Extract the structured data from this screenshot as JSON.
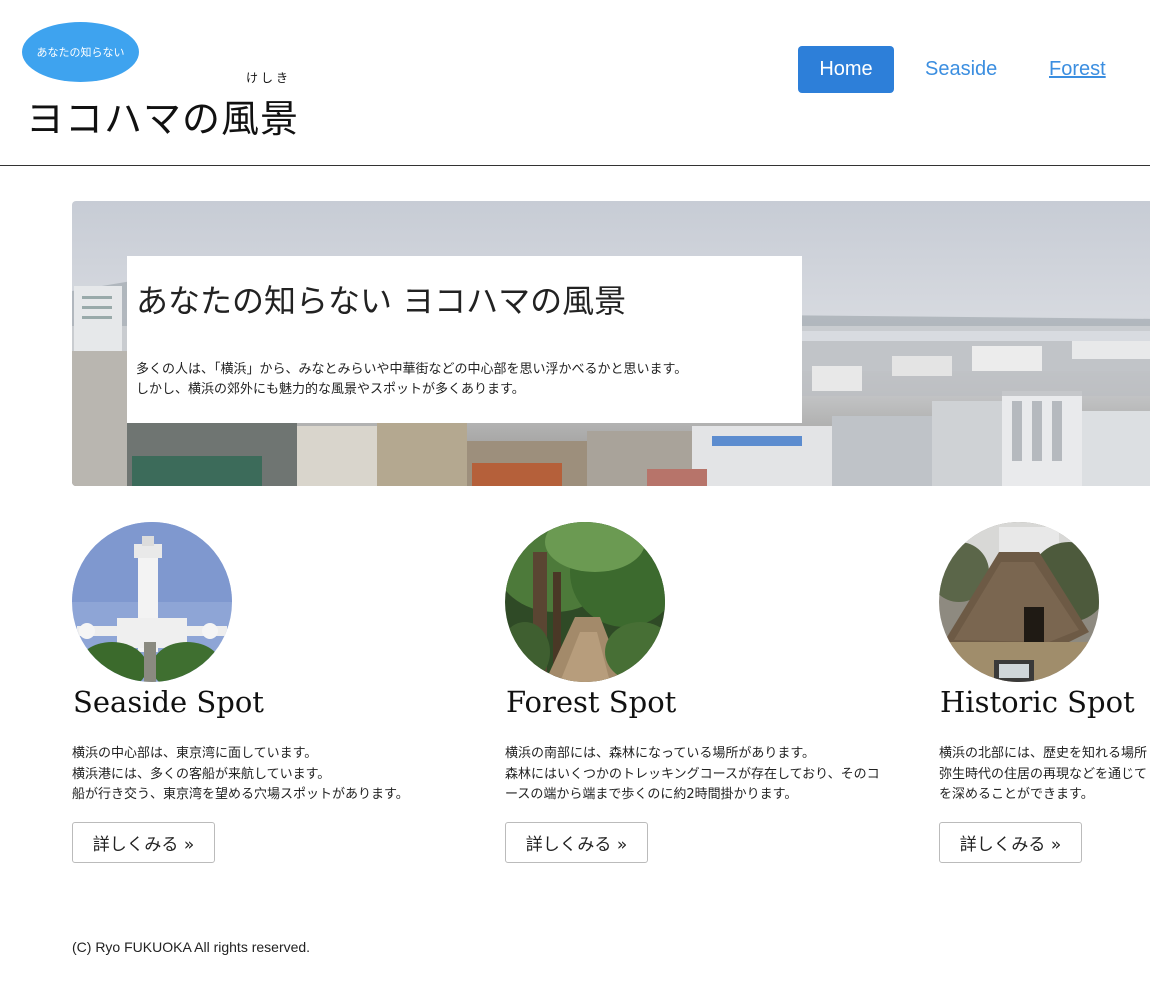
{
  "header": {
    "badge": "あなたの知らない",
    "reading": "けしき",
    "title": "ヨコハマの風景",
    "nav": {
      "home": "Home",
      "seaside": "Seaside",
      "forest": "Forest"
    }
  },
  "hero": {
    "title": "あなたの知らない ヨコハマの風景",
    "lines": [
      "多くの人は、「横浜」から、みなとみらいや中華街などの中心部を思い浮かべるかと思います。",
      "しかし、横浜の郊外にも魅力的な風景やスポットが多くあります。"
    ]
  },
  "cards": [
    {
      "title": "Seaside Spot",
      "lines": [
        "横浜の中心部は、東京湾に面しています。",
        "横浜港には、多くの客船が来航しています。",
        "船が行き交う、東京湾を望める穴場スポットがあります。"
      ],
      "button": "詳しくみる »"
    },
    {
      "title": "Forest Spot",
      "lines": [
        "横浜の南部には、森林になっている場所があります。",
        "森林にはいくつかのトレッキングコースが存在しており、そのコ",
        "ースの端から端まで歩くのに約2時間掛かります。"
      ],
      "button": "詳しくみる »"
    },
    {
      "title": "Historic Spot",
      "lines": [
        "横浜の北部には、歴史を知れる場所",
        "弥生時代の住居の再現などを通じて",
        "を深めることができます。"
      ],
      "button": "詳しくみる »"
    }
  ],
  "footer": "(C) Ryo FUKUOKA All rights reserved.",
  "colors": {
    "badge": "#3ea3ef",
    "primary": "#2d7fd9",
    "link": "#3b8ee0"
  }
}
